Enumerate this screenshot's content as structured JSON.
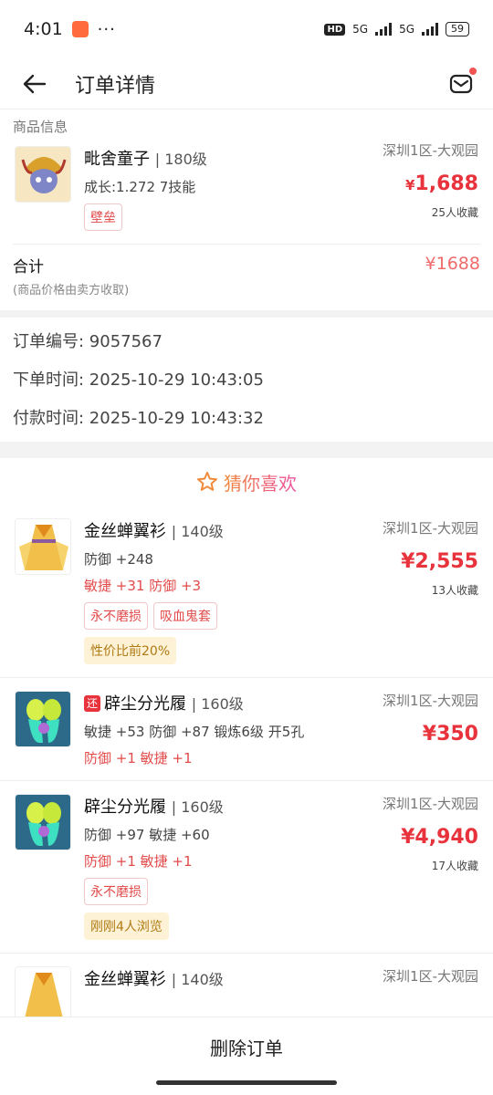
{
  "status": {
    "time": "4:01",
    "dots": "···",
    "hd": "HD",
    "net1": "5G",
    "net2": "5G",
    "battery": "59"
  },
  "header": {
    "title": "订单详情"
  },
  "goods": {
    "section_label": "商品信息",
    "name": "毗舍童子",
    "level": "| 180级",
    "growth": "成长:1.272 7技能",
    "tag": "壁垒",
    "location": "深圳1区-大观园",
    "price_symbol": "¥",
    "price": "1,688",
    "favorites": "25人收藏"
  },
  "total": {
    "label": "合计",
    "note": "(商品价格由卖方收取)",
    "value": "¥1688"
  },
  "order": {
    "number": "订单编号:  9057567",
    "created": "下单时间:  2025-10-29 10:43:05",
    "paid": "付款时间:  2025-10-29 10:43:32"
  },
  "guess": {
    "title": "猜你喜欢",
    "icon": "star-icon"
  },
  "recommendations": [
    {
      "name": "金丝蝉翼衫",
      "level": "| 140级",
      "line1": "防御 +248",
      "red": "敏捷 +31 防御 +3",
      "tags": [
        "永不磨损",
        "吸血鬼套"
      ],
      "yellow": "性价比前20%",
      "location": "深圳1区-大观园",
      "price": "2,555",
      "favorites": "13人收藏"
    },
    {
      "badge": "还",
      "name": "辟尘分光履",
      "level": "| 160级",
      "line1": "敏捷 +53 防御 +87 锻炼6级 开5孔",
      "red": "防御 +1 敏捷 +1",
      "location": "深圳1区-大观园",
      "price": "350"
    },
    {
      "name": "辟尘分光履",
      "level": "| 160级",
      "line1": "防御 +97 敏捷 +60",
      "red": "防御 +1 敏捷 +1",
      "tags": [
        "永不磨损"
      ],
      "yellow": "刚刚4人浏览",
      "location": "深圳1区-大观园",
      "price": "4,940",
      "favorites": "17人收藏"
    },
    {
      "name": "金丝蝉翼衫",
      "level": "| 140级",
      "location": "深圳1区-大观园"
    }
  ],
  "bottom": {
    "delete_label": "删除订单"
  },
  "colors": {
    "price_red": "#e8323c",
    "tag_red": "#e24a4a",
    "accent_orange": "#f08a3a"
  }
}
